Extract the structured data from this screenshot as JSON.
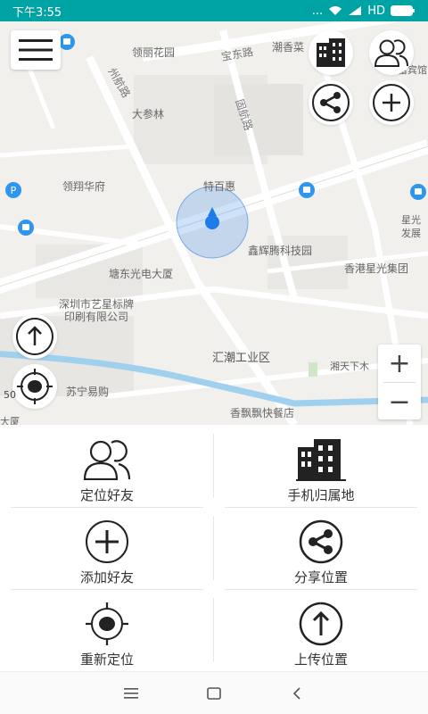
{
  "status_bar": {
    "time": "下午3:55",
    "network": "HD",
    "dots": "..."
  },
  "map": {
    "labels": {
      "lingli_garden": "领丽花园",
      "baodong_road": "宝东路",
      "chaoxiang": "潮香菜",
      "binguan": "富宾馆",
      "zhouhang_road": "州航路",
      "dashenlin": "大参林",
      "guhang_road": "固航路",
      "lingxiang": "领翔华府",
      "tebaihui": "特百惠",
      "xinghui_tech": "鑫辉腾科技园",
      "xingguang_dev": "星光",
      "fazhan": "发展",
      "tangdong": "塘东光电大厦",
      "xingguang_group": "香港星光集团",
      "yixing": "深圳市艺星标牌",
      "yinshua": "印刷有限公司",
      "huichao": "汇潮工业区",
      "xiangtian": "湘天下木",
      "suning": "苏宁易购",
      "xiangpiao": "香飘飘快餐店",
      "dasha": "大厦"
    },
    "scale": "50"
  },
  "zoom": {
    "plus": "+",
    "minus": "−"
  },
  "grid": {
    "locate_friends": "定位好友",
    "phone_location": "手机归属地",
    "add_friend": "添加好友",
    "share_location": "分享位置",
    "relocate": "重新定位",
    "upload_location": "上传位置"
  },
  "colors": {
    "status_bar": "#00a3a3",
    "location_dot": "#1f7be8",
    "bus_stop": "#2f96f0",
    "river": "#9fd0ee"
  }
}
